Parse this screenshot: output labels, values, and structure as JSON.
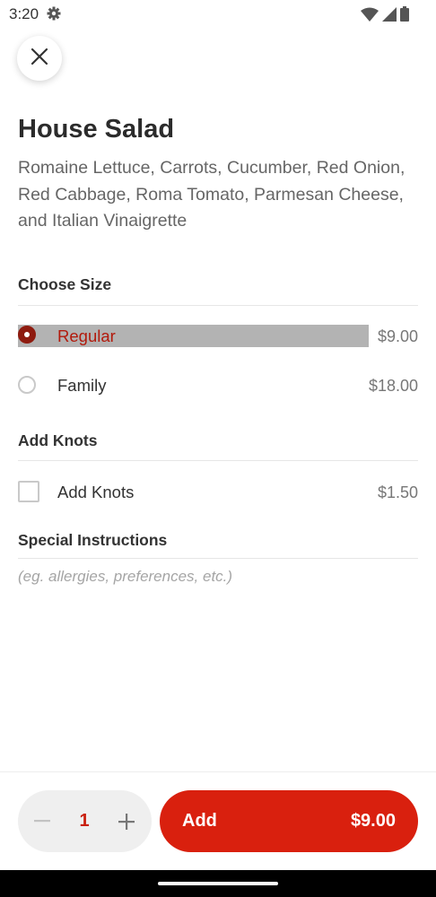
{
  "status_bar": {
    "time": "3:20",
    "icons": [
      "gear-icon",
      "wifi-icon",
      "signal-icon",
      "battery-icon"
    ]
  },
  "close_icon": "close-icon",
  "item": {
    "title": "House Salad",
    "description": "Romaine Lettuce, Carrots, Cucumber, Red Onion, Red Cabbage, Roma Tomato, Parmesan Cheese, and Italian Vinaigrette"
  },
  "size_section": {
    "heading": "Choose Size",
    "options": [
      {
        "label": "Regular",
        "price": "$9.00",
        "selected": true
      },
      {
        "label": "Family",
        "price": "$18.00",
        "selected": false
      }
    ]
  },
  "knots_section": {
    "heading": "Add Knots",
    "options": [
      {
        "label": "Add Knots",
        "price": "$1.50",
        "checked": false
      }
    ]
  },
  "instructions": {
    "heading": "Special Instructions",
    "placeholder": "(eg. allergies, preferences, etc.)"
  },
  "footer": {
    "quantity": "1",
    "add_label": "Add",
    "add_price": "$9.00"
  },
  "colors": {
    "accent": "#d9200e",
    "selected_radio": "#8e1b0f",
    "selected_text": "#b21a0c"
  }
}
